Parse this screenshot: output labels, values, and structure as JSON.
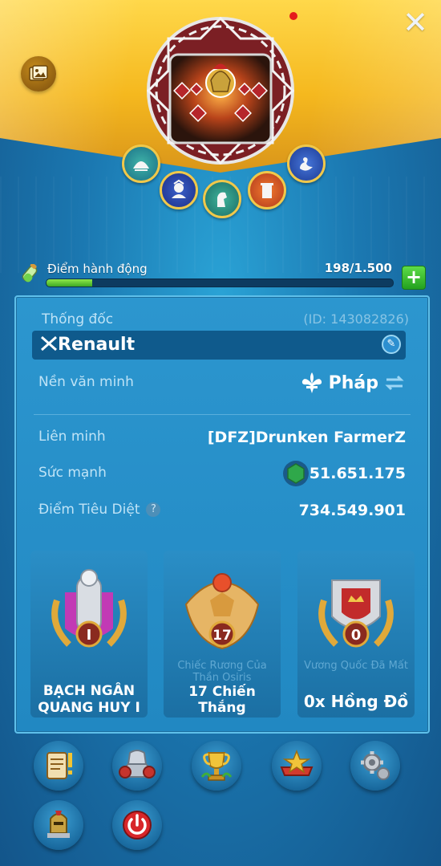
{
  "header": {
    "close_label": "✕"
  },
  "avatar": {
    "frame_title": "",
    "medals": [
      "helmet-medal",
      "general-medal",
      "knight-medal",
      "tower-medal",
      "swan-medal"
    ]
  },
  "action_points": {
    "label": "Điểm hành động",
    "value": "198/1.500",
    "fill_fraction": 0.132
  },
  "profile": {
    "governor_label": "Thống đốc",
    "governor_id": "(ID: 143082826)",
    "name": "Renault",
    "civilization_label": "Nền văn minh",
    "civilization_value": "Pháp",
    "alliance_label": "Liên minh",
    "alliance_value": "[DFZ]Drunken FarmerZ",
    "power_label": "Sức mạnh",
    "power_value": "51.651.175",
    "kill_points_label": "Điểm Tiêu Diệt",
    "kill_points_value": "734.549.901"
  },
  "cards": [
    {
      "badge_number": "I",
      "subtitle": "",
      "caption": "BẠCH NGÂN QUANG HUY I"
    },
    {
      "badge_number": "17",
      "subtitle": "Chiếc Rương Của Thần Osiris",
      "caption": "17 Chiến Thắng"
    },
    {
      "badge_number": "0",
      "subtitle": "Vương Quốc Đã Mất",
      "caption": "0x Hồng Đồ"
    }
  ],
  "colors": {
    "banner": "#f5b81e",
    "panel": "#2188c2",
    "ap_fill": "#5bd13a",
    "plus_button": "#23a11f"
  }
}
